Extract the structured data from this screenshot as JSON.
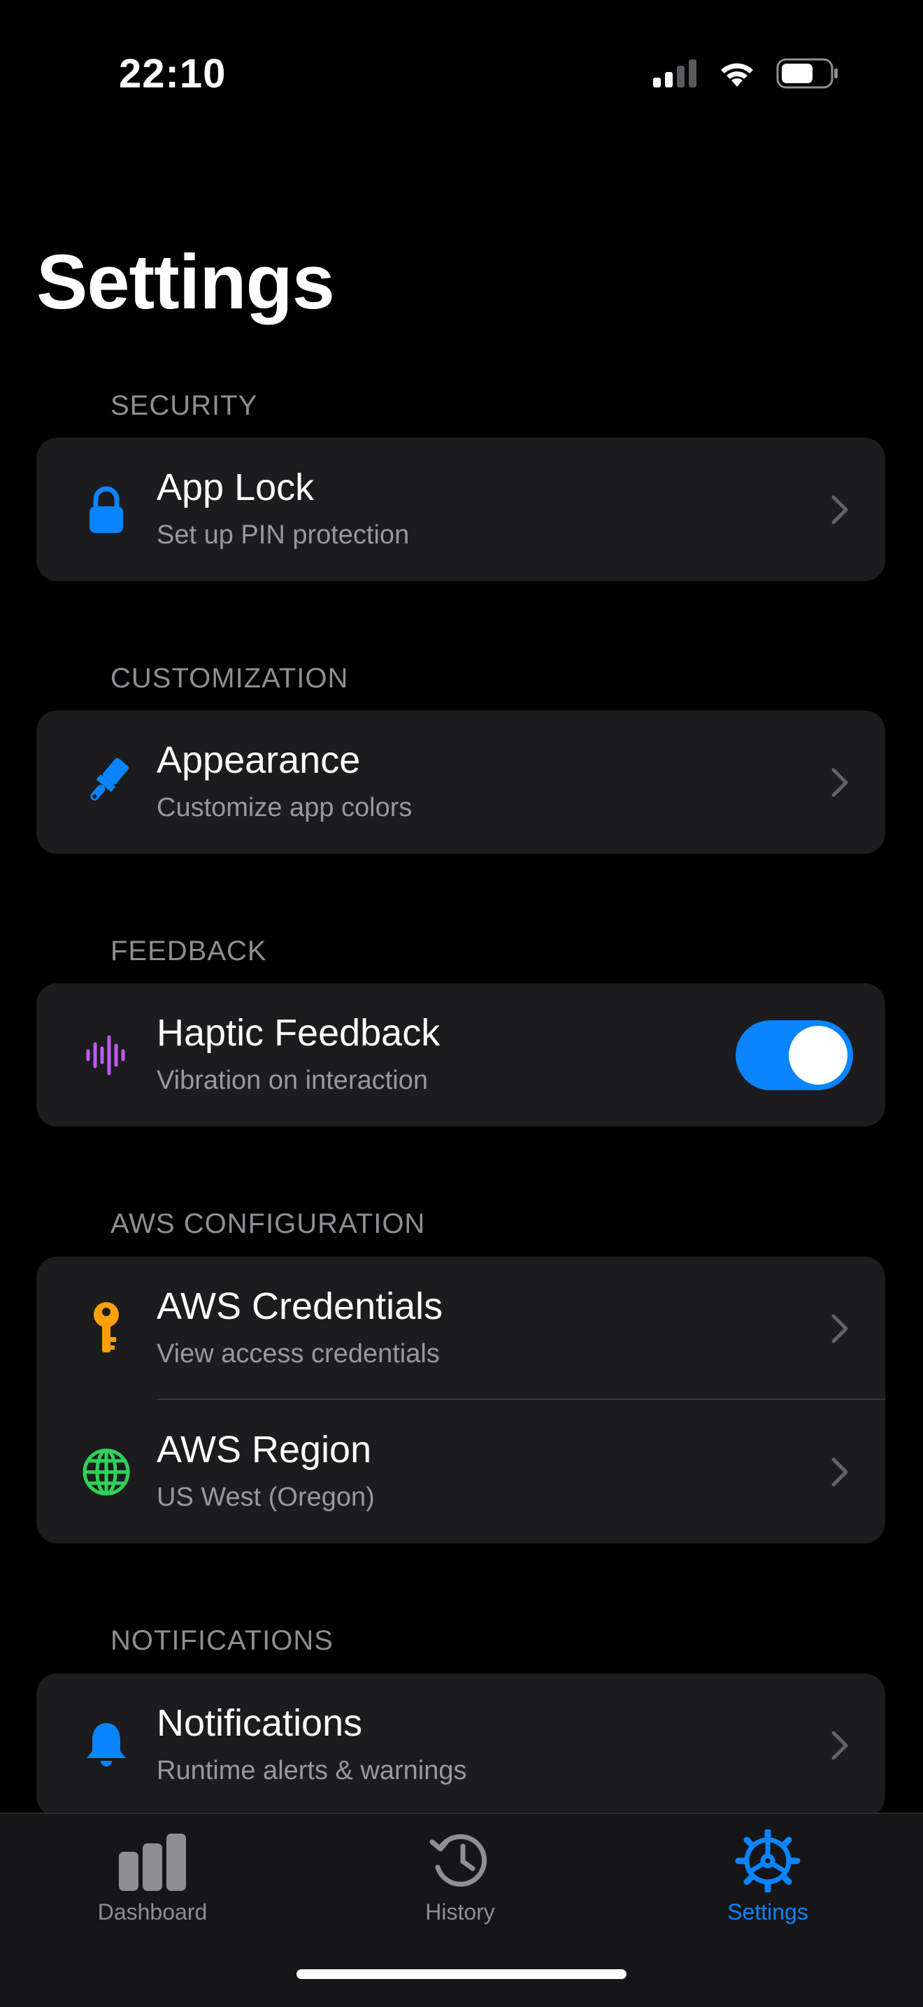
{
  "status_bar": {
    "time": "22:10",
    "icons": [
      "cellular-signal-icon",
      "wifi-icon",
      "battery-icon"
    ]
  },
  "page": {
    "title": "Settings"
  },
  "sections": {
    "security": {
      "header": "SECURITY",
      "rows": [
        {
          "icon": "lock-icon",
          "title": "App Lock",
          "subtitle": "Set up PIN protection"
        }
      ]
    },
    "customization": {
      "header": "CUSTOMIZATION",
      "rows": [
        {
          "icon": "paintbrush-icon",
          "title": "Appearance",
          "subtitle": "Customize app colors"
        }
      ]
    },
    "feedback": {
      "header": "FEEDBACK",
      "rows": [
        {
          "icon": "waveform-icon",
          "title": "Haptic Feedback",
          "subtitle": "Vibration on interaction",
          "toggle_on": true
        }
      ]
    },
    "aws": {
      "header": "AWS CONFIGURATION",
      "rows": [
        {
          "icon": "key-icon",
          "title": "AWS Credentials",
          "subtitle": "View access credentials"
        },
        {
          "icon": "globe-icon",
          "title": "AWS Region",
          "subtitle": "US West (Oregon)"
        }
      ]
    },
    "notifications": {
      "header": "NOTIFICATIONS",
      "rows": [
        {
          "icon": "bell-icon",
          "title": "Notifications",
          "subtitle": "Runtime alerts & warnings"
        }
      ]
    }
  },
  "tab_bar": {
    "tabs": [
      {
        "icon": "bar-chart-icon",
        "label": "Dashboard",
        "active": false
      },
      {
        "icon": "history-clock-icon",
        "label": "History",
        "active": false
      },
      {
        "icon": "gear-icon",
        "label": "Settings",
        "active": true
      }
    ]
  },
  "colors": {
    "accent": "#0a84ff",
    "lock": "#0a84ff",
    "paintbrush": "#0a84ff",
    "waveform": "#bf5af2",
    "key": "#ff9f0a",
    "globe": "#30d158",
    "bell": "#0a84ff",
    "background": "#000000",
    "card": "#1c1c1e"
  }
}
